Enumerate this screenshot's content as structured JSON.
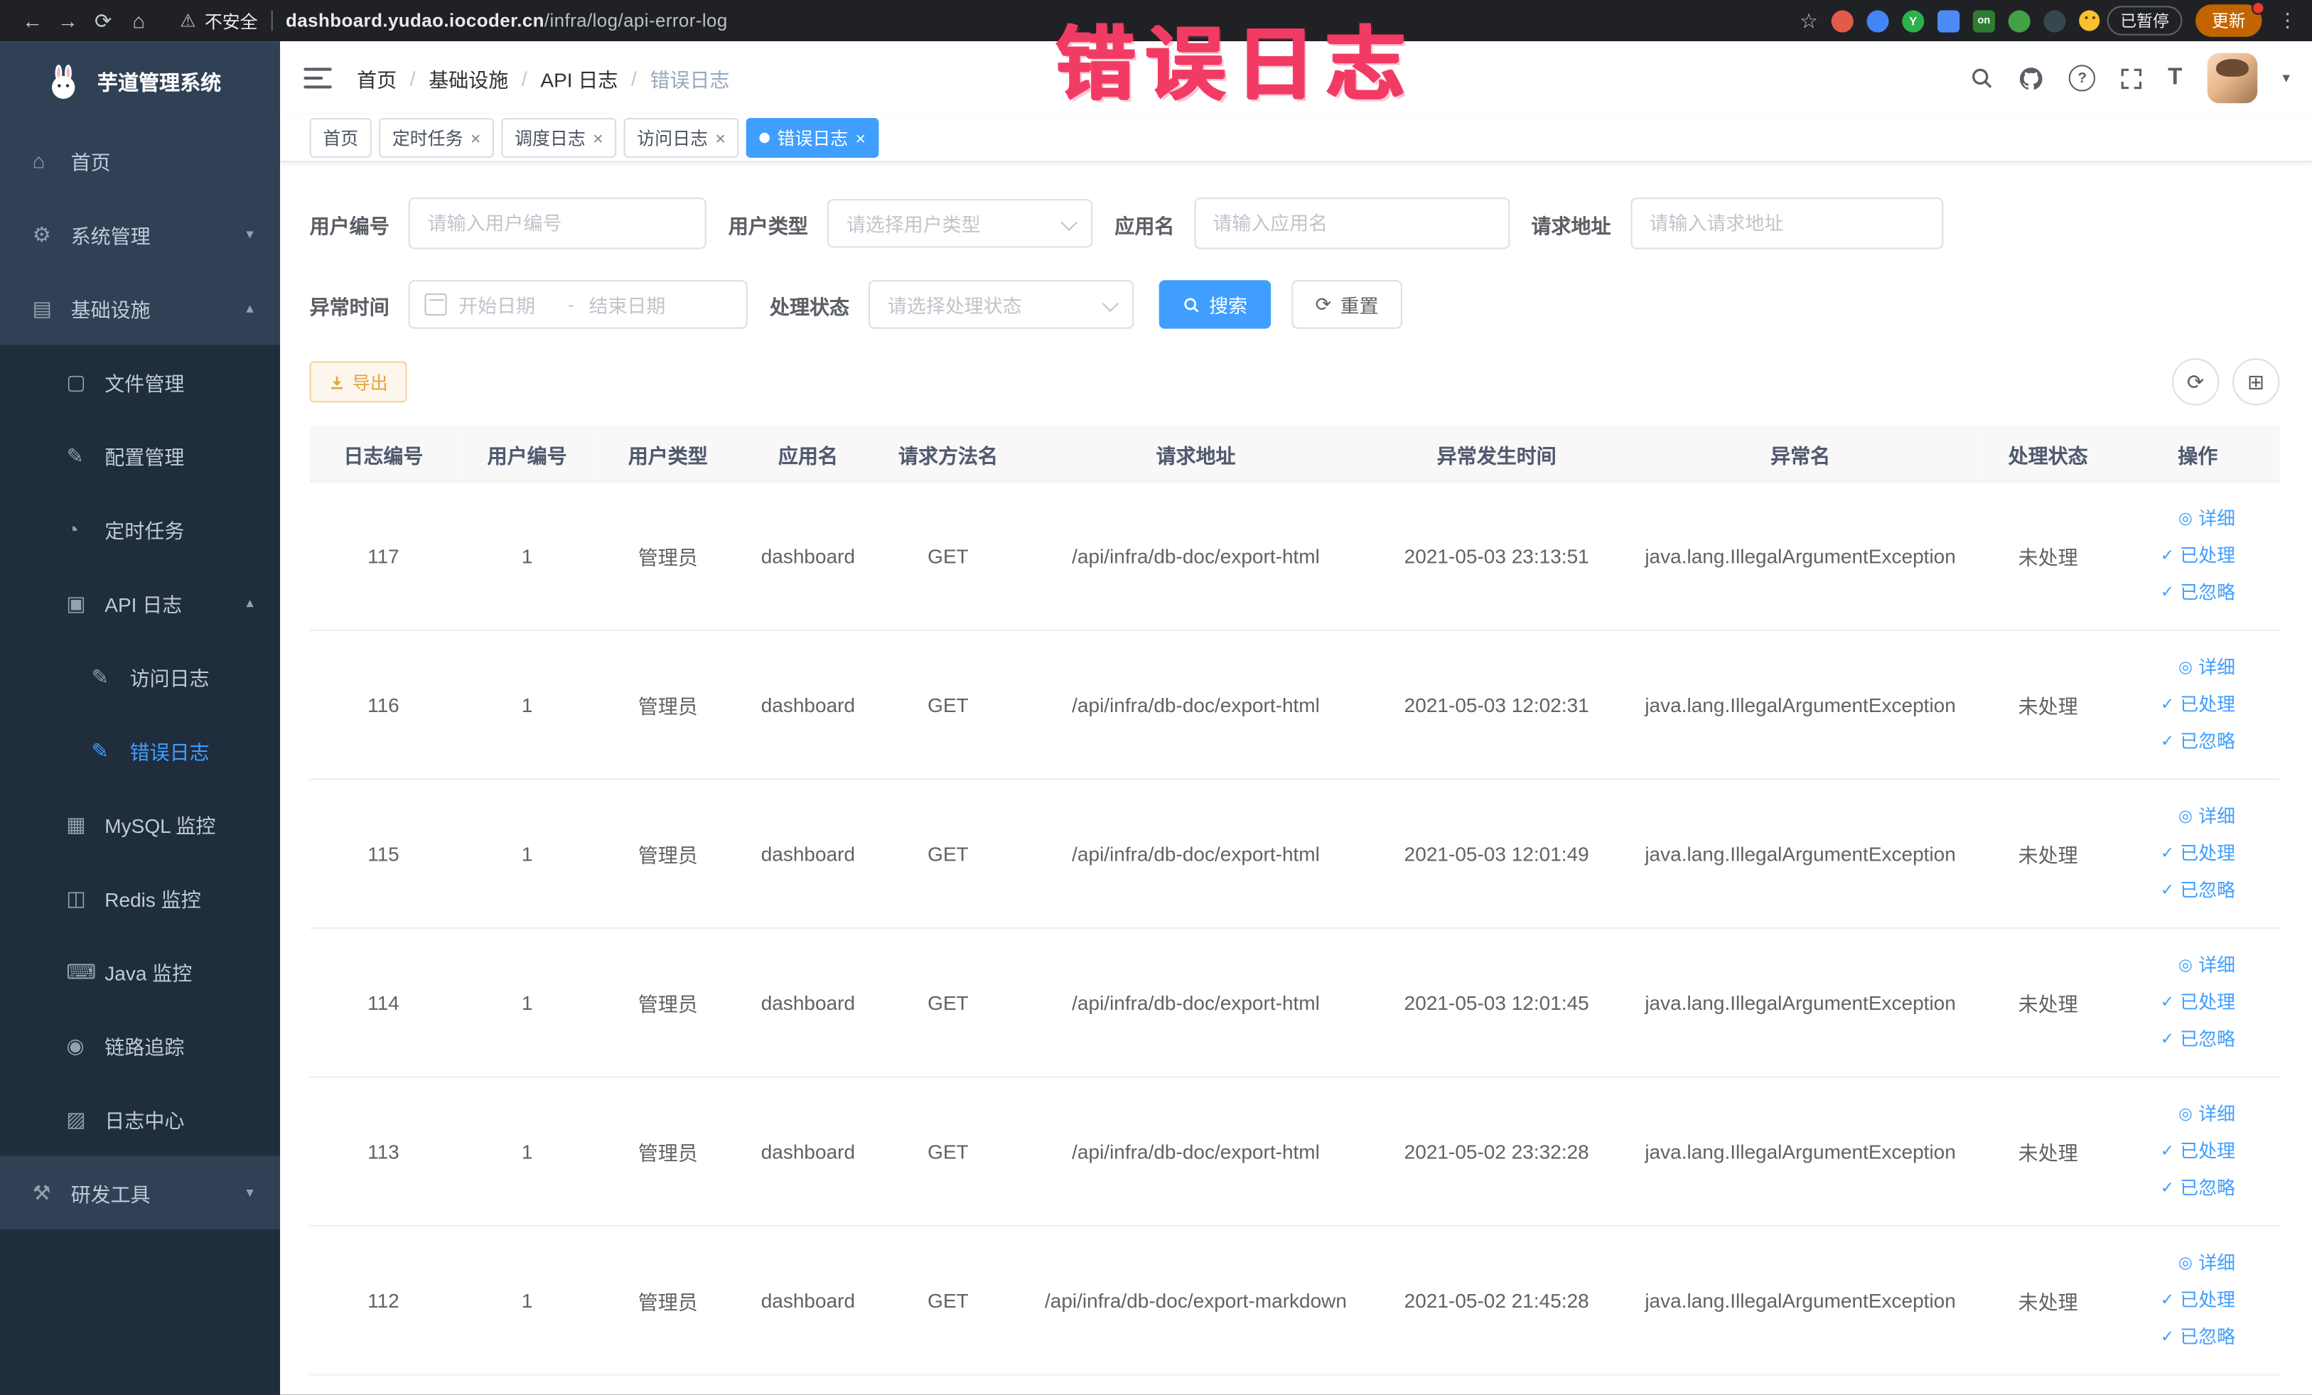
{
  "browser": {
    "security_label": "不安全",
    "url_domain": "dashboard.yudao.iocoder.cn",
    "url_path": "/infra/log/api-error-log",
    "ext_on_badge": "on",
    "ext_y_badge": "Y",
    "paused_badge": "已暂停",
    "update_button": "更新"
  },
  "annotation": "错误日志",
  "icons": {
    "back": "←",
    "forward": "→",
    "reload": "⟳",
    "home": "⌂",
    "warning": "⚠",
    "star": "☆",
    "kebab": "⋮",
    "chevron_down": "▾",
    "chevron_up": "▴",
    "close": "×",
    "caret_down": "▾",
    "eye": "◎",
    "check": "✓",
    "refresh": "⟳",
    "columns": "⊞",
    "help": "?",
    "font_size": "T"
  },
  "sidebar": {
    "logo_title": "芋道管理系统",
    "items": [
      {
        "icon": "⌂",
        "label": "首页"
      },
      {
        "icon": "⚙",
        "label": "系统管理"
      },
      {
        "icon": "▤",
        "label": "基础设施"
      },
      {
        "icon": "▢",
        "label": "文件管理"
      },
      {
        "icon": "✎",
        "label": "配置管理"
      },
      {
        "icon": "◔",
        "label": "定时任务"
      },
      {
        "icon": "▣",
        "label": "API 日志"
      },
      {
        "icon": "✎",
        "label": "访问日志"
      },
      {
        "icon": "✎",
        "label": "错误日志"
      },
      {
        "icon": "▦",
        "label": "MySQL 监控"
      },
      {
        "icon": "◫",
        "label": "Redis 监控"
      },
      {
        "icon": "⌨",
        "label": "Java 监控"
      },
      {
        "icon": "◉",
        "label": "链路追踪"
      },
      {
        "icon": "▨",
        "label": "日志中心"
      },
      {
        "icon": "⚒",
        "label": "研发工具"
      }
    ]
  },
  "header": {
    "breadcrumbs": [
      "首页",
      "基础设施",
      "API 日志",
      "错误日志"
    ],
    "separator": "/"
  },
  "tabs": [
    {
      "label": "首页",
      "closable": false,
      "active": false
    },
    {
      "label": "定时任务",
      "closable": true,
      "active": false
    },
    {
      "label": "调度日志",
      "closable": true,
      "active": false
    },
    {
      "label": "访问日志",
      "closable": true,
      "active": false
    },
    {
      "label": "错误日志",
      "closable": true,
      "active": true
    }
  ],
  "filters": {
    "user_id_label": "用户编号",
    "user_id_placeholder": "请输入用户编号",
    "user_type_label": "用户类型",
    "user_type_placeholder": "请选择用户类型",
    "app_name_label": "应用名",
    "app_name_placeholder": "请输入应用名",
    "request_url_label": "请求地址",
    "request_url_placeholder": "请输入请求地址",
    "time_label": "异常时间",
    "time_start_placeholder": "开始日期",
    "time_separator": "-",
    "time_end_placeholder": "结束日期",
    "status_label": "处理状态",
    "status_placeholder": "请选择处理状态",
    "search_button": "搜索",
    "reset_button": "重置"
  },
  "toolbar": {
    "export_button": "导出"
  },
  "table": {
    "columns": [
      "日志编号",
      "用户编号",
      "用户类型",
      "应用名",
      "请求方法名",
      "请求地址",
      "异常发生时间",
      "异常名",
      "处理状态",
      "操作"
    ],
    "actions": {
      "detail": "详细",
      "processed": "已处理",
      "ignored": "已忽略"
    },
    "rows": [
      {
        "id": "117",
        "user_id": "1",
        "user_type": "管理员",
        "app": "dashboard",
        "method": "GET",
        "url": "/api/infra/db-doc/export-html",
        "time": "2021-05-03 23:13:51",
        "exception": "java.lang.IllegalArgumentException",
        "status": "未处理"
      },
      {
        "id": "116",
        "user_id": "1",
        "user_type": "管理员",
        "app": "dashboard",
        "method": "GET",
        "url": "/api/infra/db-doc/export-html",
        "time": "2021-05-03 12:02:31",
        "exception": "java.lang.IllegalArgumentException",
        "status": "未处理"
      },
      {
        "id": "115",
        "user_id": "1",
        "user_type": "管理员",
        "app": "dashboard",
        "method": "GET",
        "url": "/api/infra/db-doc/export-html",
        "time": "2021-05-03 12:01:49",
        "exception": "java.lang.IllegalArgumentException",
        "status": "未处理"
      },
      {
        "id": "114",
        "user_id": "1",
        "user_type": "管理员",
        "app": "dashboard",
        "method": "GET",
        "url": "/api/infra/db-doc/export-html",
        "time": "2021-05-03 12:01:45",
        "exception": "java.lang.IllegalArgumentException",
        "status": "未处理"
      },
      {
        "id": "113",
        "user_id": "1",
        "user_type": "管理员",
        "app": "dashboard",
        "method": "GET",
        "url": "/api/infra/db-doc/export-html",
        "time": "2021-05-02 23:32:28",
        "exception": "java.lang.IllegalArgumentException",
        "status": "未处理"
      },
      {
        "id": "112",
        "user_id": "1",
        "user_type": "管理员",
        "app": "dashboard",
        "method": "GET",
        "url": "/api/infra/db-doc/export-markdown",
        "time": "2021-05-02 21:45:28",
        "exception": "java.lang.IllegalArgumentException",
        "status": "未处理"
      }
    ]
  }
}
